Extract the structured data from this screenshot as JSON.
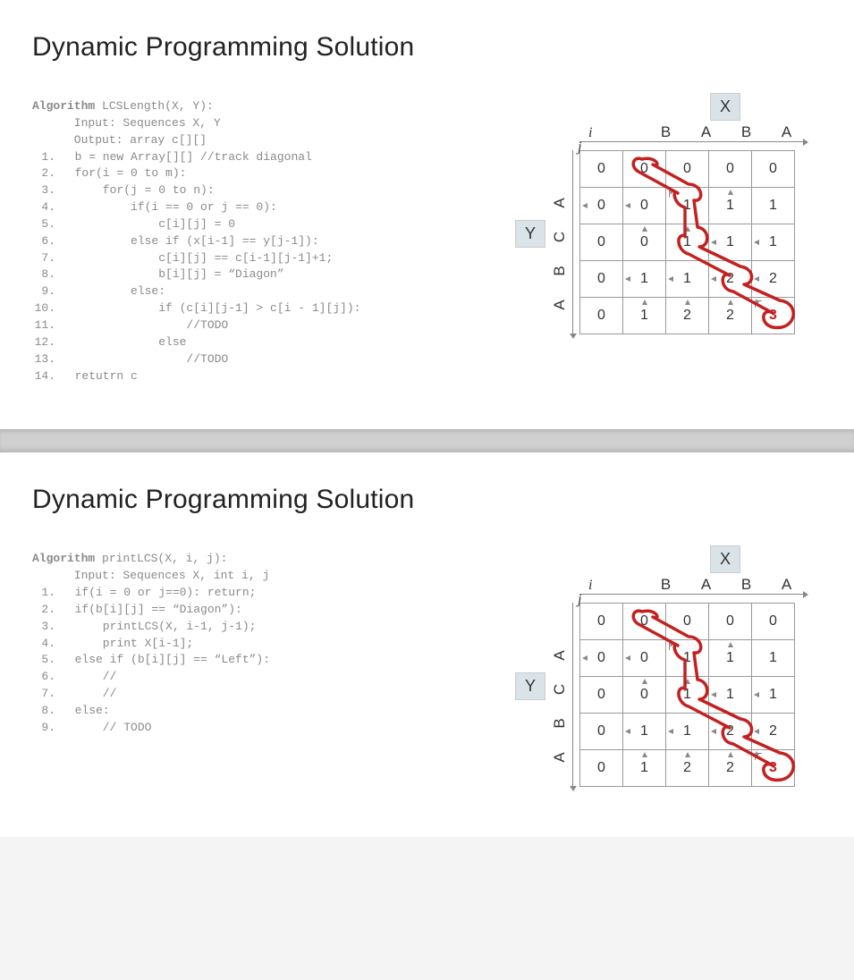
{
  "slides": [
    {
      "title": "Dynamic Programming Solution",
      "algo_name": "LCSLength(X, Y)",
      "header_lines": [
        "Input: Sequences X, Y",
        "Output: array c[][]"
      ],
      "code": [
        "b = new Array[][] //track diagonal",
        "for(i = 0 to m):",
        "    for(j = 0 to n):",
        "        if(i == 0 or j == 0):",
        "            c[i][j] = 0",
        "        else if (x[i-1] == y[j-1]):",
        "            c[i][j] == c[i-1][j-1]+1;",
        "            b[i][j] = \"Diagon\"",
        "        else:",
        "            if (c[i][j-1] > c[i - 1][j]):",
        "                //TODO",
        "            else",
        "                //TODO",
        "retutrn c"
      ]
    },
    {
      "title": "Dynamic Programming Solution",
      "algo_name": "printLCS(X, i, j)",
      "header_lines": [
        "Input: Sequences X, int i, j"
      ],
      "code": [
        "if(i = 0 or j==0): return;",
        "if(b[i][j] == \"Diagon\"):",
        "    printLCS(X, i-1, j-1);",
        "    print X[i-1];",
        "else if (b[i][j] == \"Left\"):",
        "    //",
        "    //",
        "else:",
        "    // TODO"
      ]
    }
  ],
  "dp_table": {
    "x_label": "X",
    "y_label": "Y",
    "i_label": "i",
    "j_label": "j",
    "col_headers": [
      "B",
      "A",
      "B",
      "A"
    ],
    "row_headers": [
      "A",
      "C",
      "B",
      "A"
    ],
    "cells": [
      [
        {
          "v": 0
        },
        {
          "v": 0
        },
        {
          "v": 0
        },
        {
          "v": 0
        },
        {
          "v": 0
        }
      ],
      [
        {
          "v": 0,
          "d": "left"
        },
        {
          "v": 0,
          "d": "left"
        },
        {
          "v": 1,
          "d": "diag"
        },
        {
          "v": 1,
          "d": "up"
        },
        {
          "v": 1
        }
      ],
      [
        {
          "v": 0
        },
        {
          "v": 0,
          "d": "up"
        },
        {
          "v": 1,
          "d": "up"
        },
        {
          "v": 1,
          "d": "left"
        },
        {
          "v": 1,
          "d": "left"
        }
      ],
      [
        {
          "v": 0
        },
        {
          "v": 1,
          "d": "left"
        },
        {
          "v": 1,
          "d": "left"
        },
        {
          "v": 2,
          "d": "left"
        },
        {
          "v": 2,
          "d": "left"
        }
      ],
      [
        {
          "v": 0
        },
        {
          "v": 1,
          "d": "up"
        },
        {
          "v": 2,
          "d": "up"
        },
        {
          "v": 2,
          "d": "up"
        },
        {
          "v": 3,
          "d": "diag",
          "final": true
        }
      ]
    ]
  }
}
